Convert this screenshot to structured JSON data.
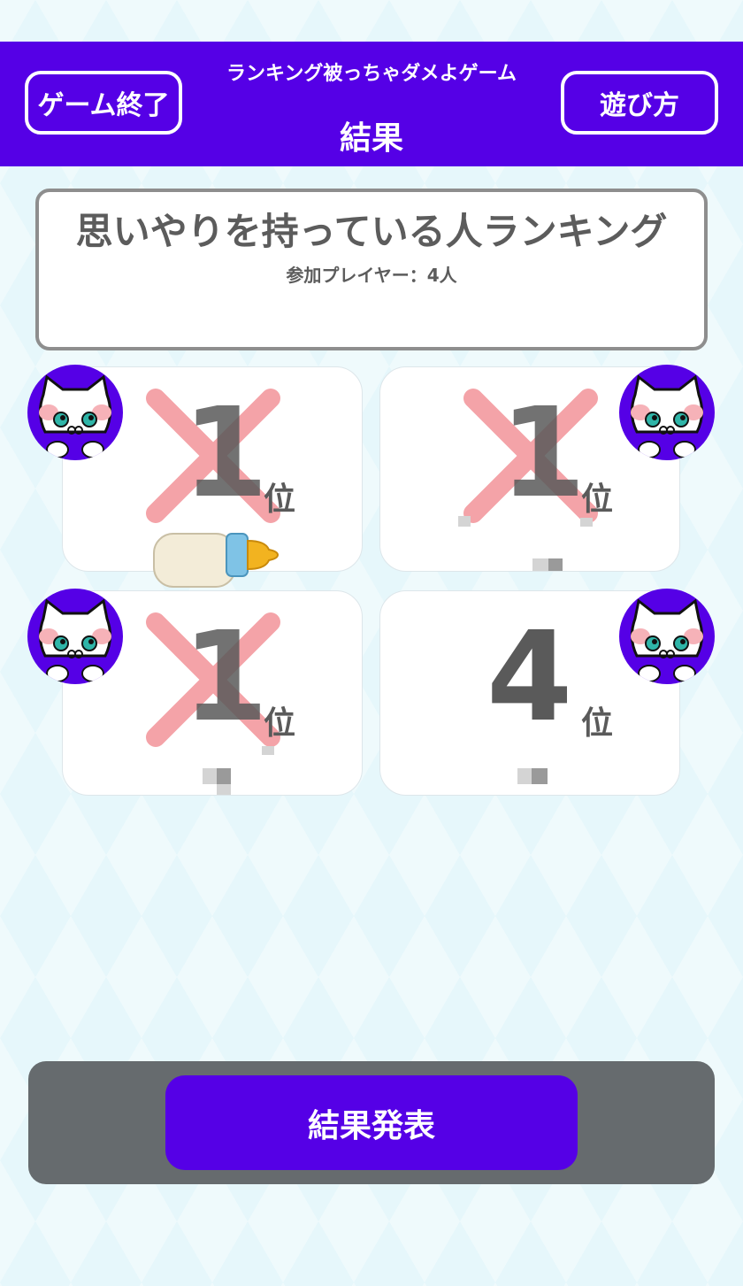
{
  "header": {
    "quit_label": "ゲーム終了",
    "subtitle": "ランキング被っちゃダメよゲーム",
    "title": "結果",
    "howto_label": "遊び方"
  },
  "theme": {
    "title": "思いやりを持っている人ランキング",
    "players": "参加プレイヤー：4人"
  },
  "cards": [
    {
      "rank": "1",
      "unit": "位",
      "crossed": true
    },
    {
      "rank": "1",
      "unit": "位",
      "crossed": true
    },
    {
      "rank": "1",
      "unit": "位",
      "crossed": true
    },
    {
      "rank": "4",
      "unit": "位",
      "crossed": false
    }
  ],
  "footer": {
    "result_label": "結果発表"
  },
  "colors": {
    "accent": "#5500e6",
    "background": "#e6f7fb",
    "cross": "#f4a3a8",
    "rank_text": "#5a5a5a"
  },
  "icons": [
    "cat-avatar-icon",
    "baby-bottle-icon",
    "cross-mark-icon"
  ]
}
